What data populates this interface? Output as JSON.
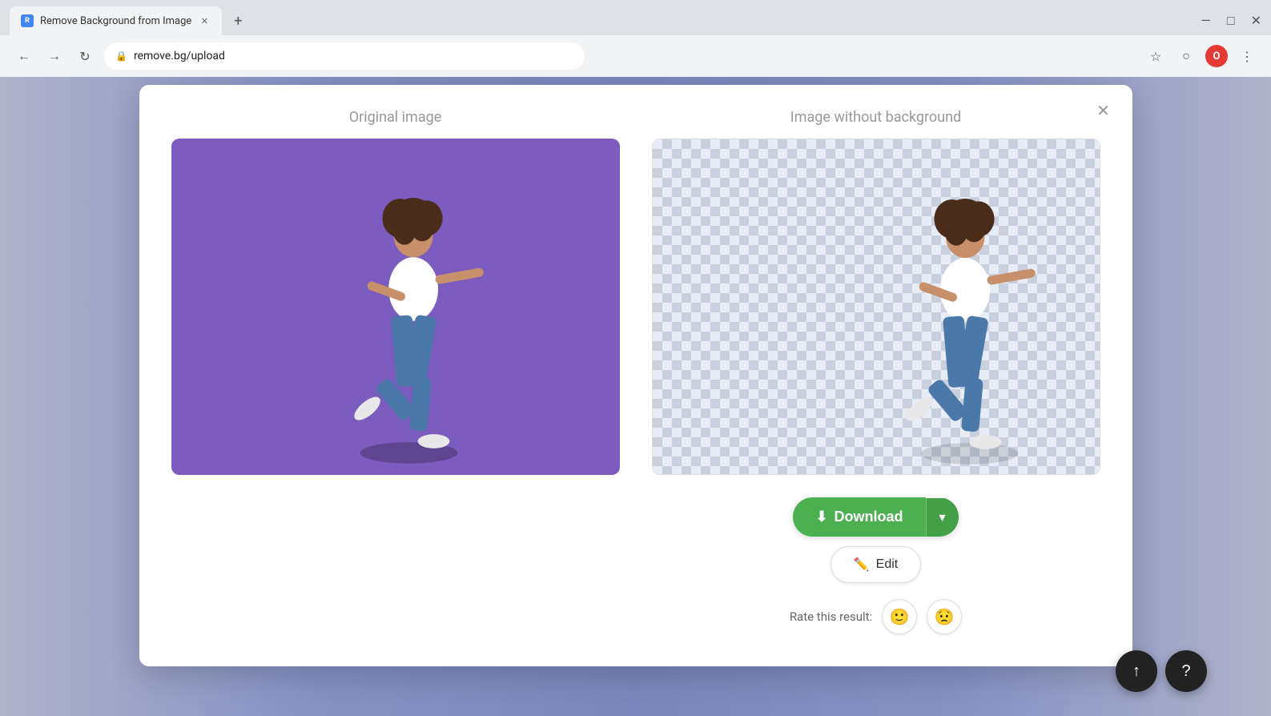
{
  "browser": {
    "tab_title": "Remove Background from Image",
    "tab_favicon": "R",
    "url": "remove.bg/upload",
    "new_tab_label": "+",
    "window_minimize": "—",
    "window_maximize": "□",
    "window_close": "✕",
    "nav_back": "←",
    "nav_forward": "→",
    "nav_reload": "↻",
    "lock_icon": "🔒",
    "profile_label": "O"
  },
  "modal": {
    "close_label": "✕",
    "original_label": "Original image",
    "processed_label": "Image without background",
    "download_label": "Download",
    "download_icon": "⬇",
    "dropdown_icon": "▾",
    "edit_label": "Edit",
    "edit_icon": "✏",
    "rate_label": "Rate this result:",
    "rate_happy_icon": "🙂",
    "rate_sad_icon": "😟"
  },
  "floating": {
    "upload_icon": "↑",
    "help_icon": "?"
  }
}
